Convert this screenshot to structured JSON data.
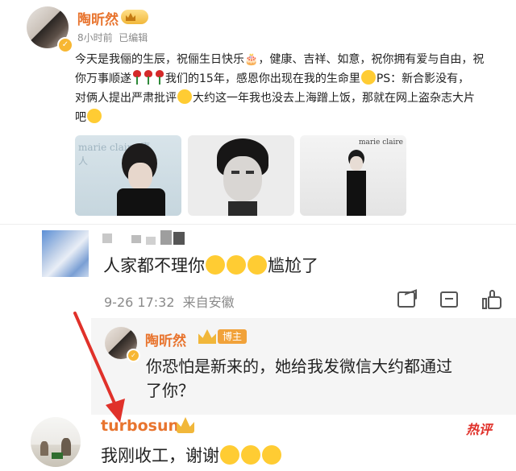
{
  "post": {
    "author": "陶昕然",
    "vip_label": "✓",
    "meta": "8小时前  已编辑",
    "line1": "今天是我俪的生辰，祝俪生日快乐🎂，健康、吉祥、如意，祝你拥有爱与自由，祝",
    "line2_a": "你万事顺遂",
    "line2_b": "我们的15年，感恩你出现在我的生命里",
    "line2_c": "PS：新合影没有，",
    "line3": "对俩人提出严肃批评",
    "line3_b": "大约这一年我也没去上海蹭上饭，那就在网上盗杂志大片",
    "line4": "吧",
    "img1_text": "marie claire 嘉人",
    "img3_text": "marie claire"
  },
  "comment1": {
    "text": "人家都不理你",
    "text_b": "尴尬了",
    "meta": "9-26 17:32  来自安徽"
  },
  "reply": {
    "author": "陶昕然",
    "role": "博主",
    "line1": "你恐怕是新来的，她给我发微信大约都通过",
    "line2": "了你？"
  },
  "comment2": {
    "author": "turbosun",
    "text": "我刚收工，谢谢",
    "hot_label": "热评"
  },
  "colors": {
    "accent": "#e8742e",
    "gold": "#f7b733",
    "arrow": "#e0312a"
  }
}
